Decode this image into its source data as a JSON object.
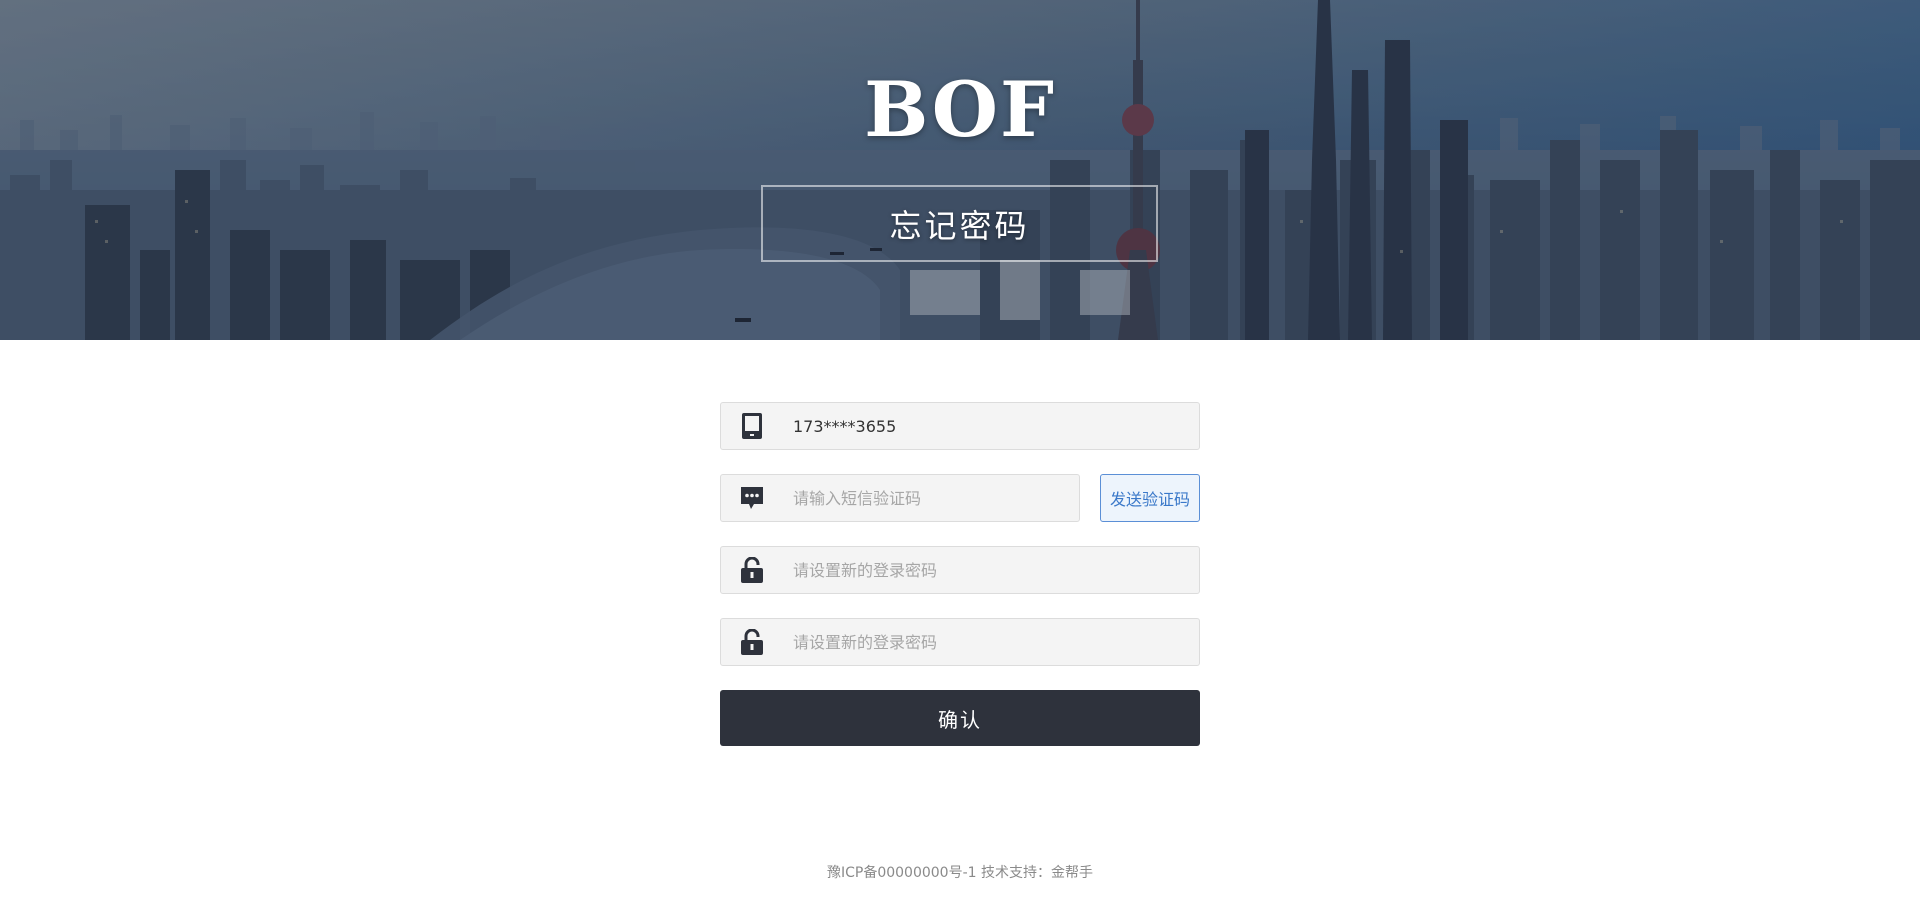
{
  "banner": {
    "brand": "BOF",
    "page_title": "忘记密码"
  },
  "form": {
    "phone": {
      "value": "173****3655",
      "icon": "mobile-phone-icon"
    },
    "sms_code": {
      "placeholder": "请输入短信验证码",
      "icon": "message-icon",
      "send_button_label": "发送验证码"
    },
    "new_password": {
      "placeholder": "请设置新的登录密码",
      "icon": "unlock-icon"
    },
    "confirm_password": {
      "placeholder": "请设置新的登录密码",
      "icon": "unlock-icon"
    },
    "confirm_button_label": "确认"
  },
  "footer": {
    "text": "豫ICP备00000000号-1 技术支持：金帮手"
  },
  "colors": {
    "primary_dark": "#2e323c",
    "link_blue": "#3a78c9",
    "field_bg": "#f4f4f4",
    "placeholder": "#a6a6a6"
  }
}
